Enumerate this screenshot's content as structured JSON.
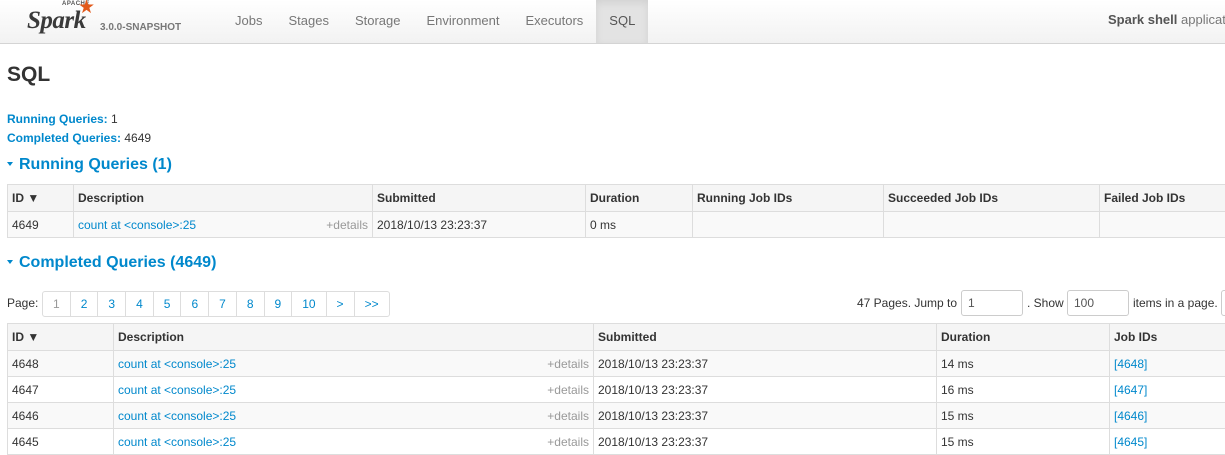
{
  "brand": {
    "apache": "APACHE",
    "name": "Spark",
    "version": "3.0.0-SNAPSHOT"
  },
  "nav": {
    "tabs": [
      "Jobs",
      "Stages",
      "Storage",
      "Environment",
      "Executors",
      "SQL"
    ],
    "active": "SQL"
  },
  "app": {
    "name": "Spark shell",
    "suffix": "applicat"
  },
  "page": {
    "title": "SQL"
  },
  "summary": {
    "running_label": "Running Queries:",
    "running_value": "1",
    "completed_label": "Completed Queries:",
    "completed_value": "4649"
  },
  "running": {
    "heading": "Running Queries (1)",
    "columns": [
      "ID ▼",
      "Description",
      "Submitted",
      "Duration",
      "Running Job IDs",
      "Succeeded Job IDs",
      "Failed Job IDs"
    ],
    "rows": [
      {
        "id": "4649",
        "desc": "count at <console>:25",
        "details": "+details",
        "submitted": "2018/10/13 23:23:37",
        "duration": "0 ms",
        "running": "",
        "succeeded": "",
        "failed": ""
      }
    ]
  },
  "completed": {
    "heading": "Completed Queries (4649)",
    "pager": {
      "label": "Page:",
      "pages": [
        "1",
        "2",
        "3",
        "4",
        "5",
        "6",
        "7",
        "8",
        "9",
        "10",
        ">",
        ">>"
      ],
      "current": "1",
      "total_text": "47 Pages. Jump to",
      "jump_value": "1",
      "show_label": ". Show",
      "show_value": "100",
      "items_label": "items in a page."
    },
    "columns": [
      "ID ▼",
      "Description",
      "Submitted",
      "Duration",
      "Job IDs"
    ],
    "rows": [
      {
        "id": "4648",
        "desc": "count at <console>:25",
        "details": "+details",
        "submitted": "2018/10/13 23:23:37",
        "duration": "14 ms",
        "jobs": "[4648]"
      },
      {
        "id": "4647",
        "desc": "count at <console>:25",
        "details": "+details",
        "submitted": "2018/10/13 23:23:37",
        "duration": "16 ms",
        "jobs": "[4647]"
      },
      {
        "id": "4646",
        "desc": "count at <console>:25",
        "details": "+details",
        "submitted": "2018/10/13 23:23:37",
        "duration": "15 ms",
        "jobs": "[4646]"
      },
      {
        "id": "4645",
        "desc": "count at <console>:25",
        "details": "+details",
        "submitted": "2018/10/13 23:23:37",
        "duration": "15 ms",
        "jobs": "[4645]"
      }
    ]
  }
}
